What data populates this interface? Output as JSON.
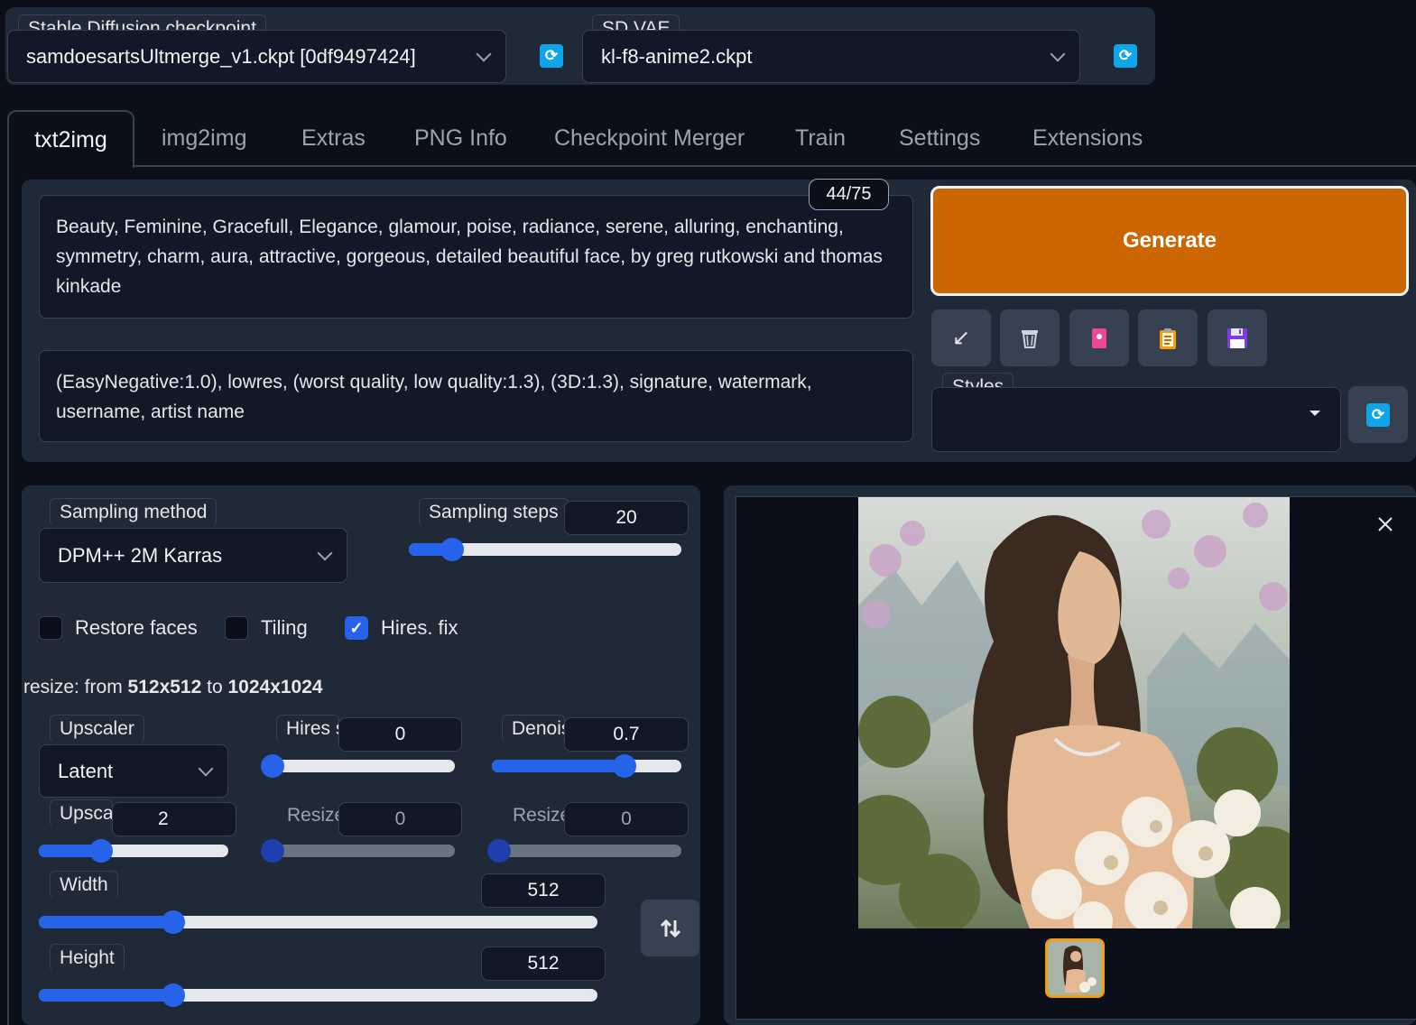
{
  "checkpoint": {
    "label": "Stable Diffusion checkpoint",
    "value": "samdoesartsUltmerge_v1.ckpt [0df9497424]",
    "refresh_icon": "refresh-icon"
  },
  "vae": {
    "label": "SD VAE",
    "value": "kl-f8-anime2.ckpt",
    "refresh_icon": "refresh-icon"
  },
  "tabs": [
    {
      "label": "txt2img",
      "active": true
    },
    {
      "label": "img2img"
    },
    {
      "label": "Extras"
    },
    {
      "label": "PNG Info"
    },
    {
      "label": "Checkpoint Merger"
    },
    {
      "label": "Train"
    },
    {
      "label": "Settings"
    },
    {
      "label": "Extensions"
    }
  ],
  "prompt": {
    "token_counter": "44/75",
    "positive": "Beauty, Feminine, Gracefull, Elegance, glamour, poise, radiance, serene, alluring, enchanting, symmetry, charm, aura, attractive, gorgeous, detailed beautiful face, by greg rutkowski and thomas kinkade",
    "negative": "(EasyNegative:1.0), lowres, (worst quality, low quality:1.3), (3D:1.3), signature, watermark, username, artist name"
  },
  "generate": {
    "label": "Generate"
  },
  "tool_buttons": [
    "read-params-icon",
    "trash-icon",
    "style-apply-icon",
    "clipboard-icon",
    "save-icon"
  ],
  "styles": {
    "label": "Styles",
    "value": ""
  },
  "sampling": {
    "method_label": "Sampling method",
    "method_value": "DPM++ 2M Karras",
    "steps_label": "Sampling steps",
    "steps_value": "20",
    "steps_fraction": 0.16
  },
  "checkboxes": [
    {
      "label": "Restore faces",
      "checked": false
    },
    {
      "label": "Tiling",
      "checked": false
    },
    {
      "label": "Hires. fix",
      "checked": true
    }
  ],
  "hires": {
    "resize_prefix": "resize: from ",
    "from_size": "512x512",
    "to_word": " to ",
    "to_size": "1024x1024",
    "upscaler_label": "Upscaler",
    "upscaler_value": "Latent",
    "hires_steps_label": "Hires steps",
    "hires_steps_value": "0",
    "hires_steps_fraction": 0.0,
    "denoise_label": "Denoising strength",
    "denoise_value": "0.7",
    "denoise_fraction": 0.7,
    "upscale_by_label": "Upscale by",
    "upscale_by_value": "2",
    "upscale_by_fraction": 0.33,
    "resize_w_label": "Resize width to",
    "resize_w_value": "0",
    "resize_h_label": "Resize height to",
    "resize_h_value": "0"
  },
  "size": {
    "width_label": "Width",
    "width_value": "512",
    "width_fraction": 0.24,
    "height_label": "Height",
    "height_value": "512",
    "height_fraction": 0.24,
    "swap_icon": "swap-dimensions-icon"
  },
  "gallery": {
    "close_icon": "close-icon",
    "image": "generated-portrait-image",
    "thumbnail": "generated-portrait-thumbnail"
  },
  "colors": {
    "accent": "#cc6600",
    "slider": "#2563eb",
    "panel": "#1f2937",
    "background": "#0b0f19"
  }
}
